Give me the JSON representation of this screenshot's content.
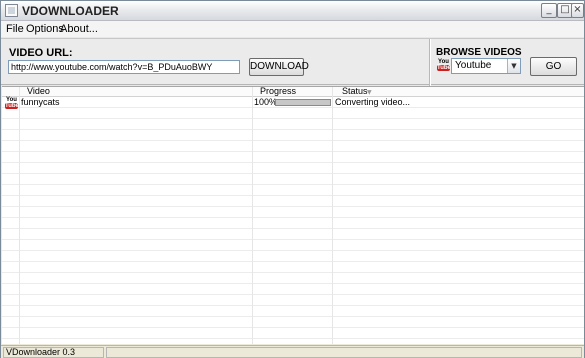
{
  "window": {
    "title": "VDOWNLOADER",
    "controls": {
      "minimize": "_",
      "maximize": "□",
      "close": "×"
    }
  },
  "menu": {
    "items": [
      "File",
      "Options",
      "About..."
    ]
  },
  "url_panel": {
    "label": "VIDEO URL:",
    "url_value": "http://www.youtube.com/watch?v=B_PDuAuoBWY",
    "download_label": "DOWNLOAD"
  },
  "browse_panel": {
    "label": "BROWSE VIDEOS",
    "selected_source": "Youtube",
    "source_icon": "youtube-icon",
    "go_label": "GO"
  },
  "list": {
    "columns": [
      "Video",
      "Progress",
      "Status"
    ],
    "sort_column": "Status",
    "rows": [
      {
        "source_icon": "youtube-icon",
        "video": "funnycats",
        "progress_percent": 100,
        "progress_text": "100%",
        "status": "Converting video..."
      }
    ]
  },
  "youtube_logo": {
    "you": "You",
    "tube": "Tube"
  },
  "statusbar": {
    "text": "VDownloader 0.3"
  },
  "colors": {
    "window_bg": "#ece9d8",
    "youtube_red": "#cc1f1f",
    "input_border": "#7f9db9"
  }
}
